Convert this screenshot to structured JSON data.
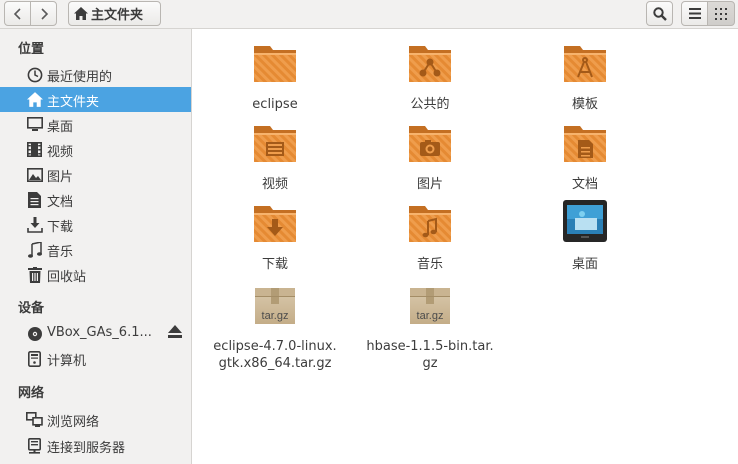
{
  "toolbar": {
    "back_icon": "chevron-left-icon",
    "forward_icon": "chevron-right-icon",
    "breadcrumb": "主文件夹",
    "breadcrumb_icon": "home-icon"
  },
  "sidebar": {
    "sections": [
      {
        "title": "位置"
      },
      {
        "title": "设备"
      },
      {
        "title": "网络"
      }
    ],
    "places": [
      {
        "label": "最近使用的",
        "icon": "clock-icon"
      },
      {
        "label": "主文件夹",
        "icon": "home-icon",
        "selected": true
      },
      {
        "label": "桌面",
        "icon": "desktop-icon"
      },
      {
        "label": "视频",
        "icon": "video-icon"
      },
      {
        "label": "图片",
        "icon": "image-icon"
      },
      {
        "label": "文档",
        "icon": "document-icon"
      },
      {
        "label": "下载",
        "icon": "download-icon"
      },
      {
        "label": "音乐",
        "icon": "music-icon"
      },
      {
        "label": "回收站",
        "icon": "trash-icon"
      }
    ],
    "devices": [
      {
        "label": "VBox_GAs_6.1...",
        "icon": "disc-icon",
        "eject_icon": "eject-icon"
      },
      {
        "label": "计算机",
        "icon": "computer-icon"
      }
    ],
    "network": [
      {
        "label": "浏览网络",
        "icon": "network-icon"
      },
      {
        "label": "连接到服务器",
        "icon": "server-icon"
      }
    ]
  },
  "files": [
    {
      "name": "eclipse",
      "icon": "folder-icon"
    },
    {
      "name": "公共的",
      "icon": "folder-public-icon"
    },
    {
      "name": "模板",
      "icon": "folder-templates-icon"
    },
    {
      "name": "视频",
      "icon": "folder-video-icon"
    },
    {
      "name": "图片",
      "icon": "folder-pictures-icon"
    },
    {
      "name": "文档",
      "icon": "folder-documents-icon"
    },
    {
      "name": "下载",
      "icon": "folder-download-icon"
    },
    {
      "name": "音乐",
      "icon": "folder-music-icon"
    },
    {
      "name": "桌面",
      "icon": "desktop-folder-icon"
    },
    {
      "name": "eclipse-4.7.0-linux.gtk.x86_64.tar.gz",
      "name_lines": [
        "eclipse-4.7.0-linux.",
        "gtk.x86_64.tar.gz"
      ],
      "icon": "archive-icon",
      "badge": "tar.gz"
    },
    {
      "name": "hbase-1.1.5-bin.tar.gz",
      "name_lines": [
        "hbase-1.1.5-bin.tar.",
        "gz"
      ],
      "icon": "archive-icon",
      "badge": "tar.gz"
    }
  ],
  "colors": {
    "folder_orange": "#e0872f",
    "selection_blue": "#4ba3e2"
  }
}
